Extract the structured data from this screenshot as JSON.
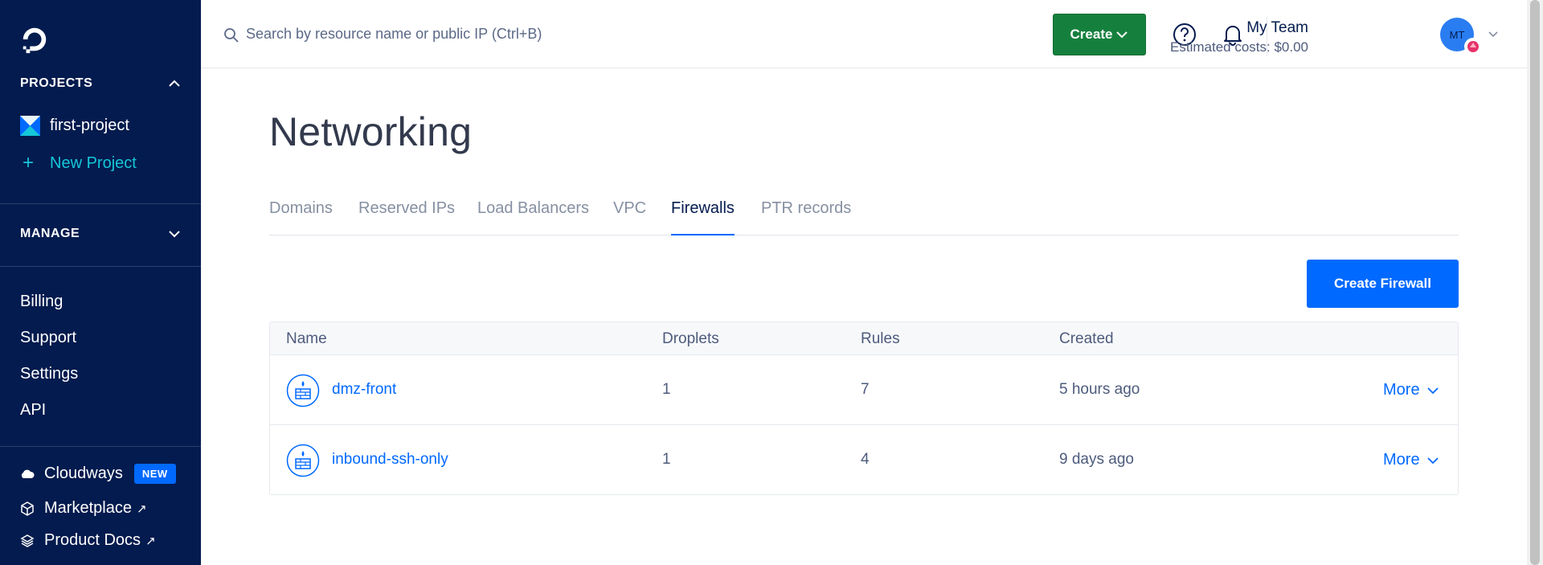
{
  "sidebar": {
    "projects_heading": "PROJECTS",
    "project_name": "first-project",
    "new_project_label": "New Project",
    "manage_heading": "MANAGE",
    "nav": [
      "Billing",
      "Support",
      "Settings",
      "API"
    ],
    "bottom": {
      "cloudways": "Cloudways",
      "new_badge": "NEW",
      "marketplace": "Marketplace",
      "product_docs": "Product Docs"
    }
  },
  "topbar": {
    "search_placeholder": "Search by resource name or public IP (Ctrl+B)",
    "create_label": "Create",
    "team_name": "My Team",
    "estimated_costs": "Estimated costs: $0.00",
    "avatar_initials": "MT"
  },
  "main": {
    "title": "Networking",
    "tabs": [
      "Domains",
      "Reserved IPs",
      "Load Balancers",
      "VPC",
      "Firewalls",
      "PTR records"
    ],
    "active_tab": "Firewalls",
    "create_firewall_label": "Create Firewall",
    "table": {
      "headers": [
        "Name",
        "Droplets",
        "Rules",
        "Created"
      ],
      "rows": [
        {
          "name": "dmz-front",
          "droplets": "1",
          "rules": "7",
          "created": "5 hours ago",
          "more": "More"
        },
        {
          "name": "inbound-ssh-only",
          "droplets": "1",
          "rules": "4",
          "created": "9 days ago",
          "more": "More"
        }
      ]
    }
  },
  "colors": {
    "sidebar_bg": "#031b4e",
    "primary": "#0069ff",
    "create_green": "#15803d",
    "accent_teal": "#14c7d9"
  }
}
